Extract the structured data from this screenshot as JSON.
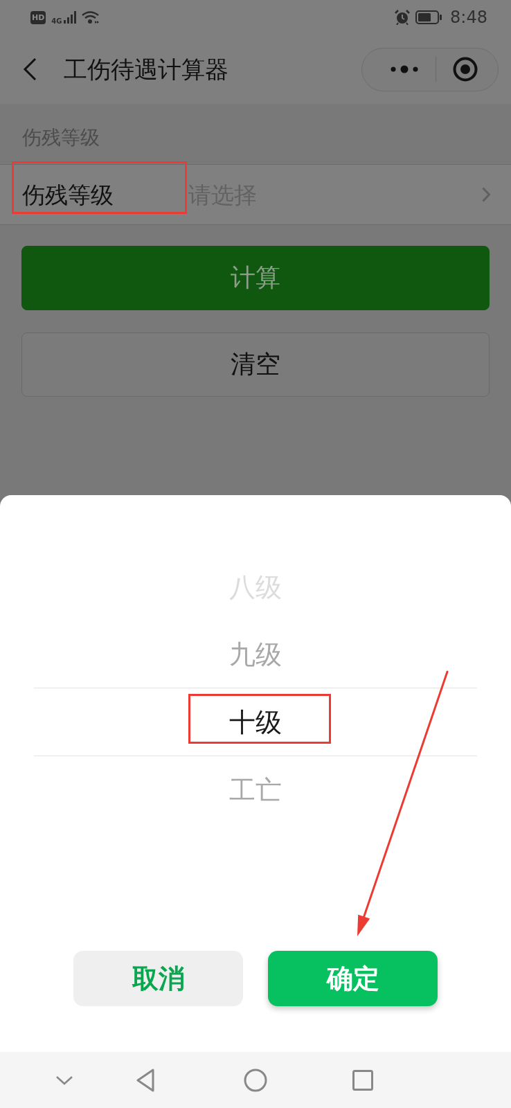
{
  "status_bar": {
    "hd_badge": "HD",
    "network": "4G",
    "time": "8:48"
  },
  "nav_bar": {
    "title": "工伤待遇计算器"
  },
  "form": {
    "section_label": "伤残等级",
    "field": {
      "label": "伤残等级",
      "placeholder": "请选择",
      "annotated": true
    },
    "buttons": [
      {
        "label": "计算",
        "kind": "primary"
      },
      {
        "label": "清空",
        "kind": "default"
      }
    ]
  },
  "picker": {
    "items": [
      {
        "label": "八级",
        "selected": false,
        "annotated": false
      },
      {
        "label": "九级",
        "selected": false,
        "annotated": false
      },
      {
        "label": "十级",
        "selected": true,
        "annotated": true
      },
      {
        "label": "工亡",
        "selected": false,
        "annotated": false
      }
    ],
    "buttons": [
      {
        "label": "取消",
        "kind": "cancel",
        "annotated": false
      },
      {
        "label": "确定",
        "kind": "confirm",
        "annotated": true
      }
    ]
  }
}
